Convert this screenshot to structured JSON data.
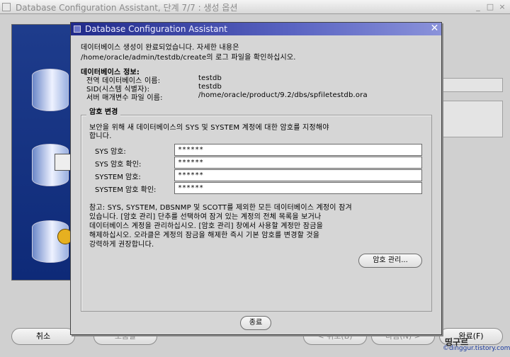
{
  "background_window": {
    "title": "Database Configuration Assistant, 단계 7/7 : 생성 옵션",
    "buttons": {
      "cancel": "취소",
      "help": "도움말",
      "back": "< 뒤로(B)",
      "next": "다음(N) >",
      "finish": "완료(F)"
    }
  },
  "dialog": {
    "title": "Database Configuration Assistant",
    "intro_line1": "데이터베이스 생성이 완료되었습니다. 자세한 내용은",
    "intro_line2": "/home/oracle/admin/testdb/create의 로그 파일을 확인하십시오.",
    "info_header": "데이터베이스 정보:",
    "info": [
      {
        "label": "전역 데이터베이스 이름:",
        "value": "testdb"
      },
      {
        "label": "SID(시스템 식별자):",
        "value": "testdb"
      },
      {
        "label": "서버 매개변수 파일 이름:",
        "value": "/home/oracle/product/9.2/dbs/spfiletestdb.ora"
      }
    ],
    "password_group": {
      "title": "암호 변경",
      "desc_line1": "보안을 위해 새 데이터베이스의 SYS 및 SYSTEM 계정에 대한 암호를 지정해야",
      "desc_line2": "합니다.",
      "fields": [
        {
          "label": "SYS 암호:",
          "value": "******"
        },
        {
          "label": "SYS 암호 확인:",
          "value": "******"
        },
        {
          "label": "SYSTEM 암호:",
          "value": "******"
        },
        {
          "label": "SYSTEM 암호 확인:",
          "value": "******"
        }
      ],
      "note_lines": [
        "참고: SYS, SYSTEM, DBSNMP 및 SCOTT를 제외한 모든 데이터베이스 계정이 잠겨",
        "있습니다. [암호 관리] 단추를 선택하여 잠겨 있는 계정의 전체 목록을 보거나",
        "데이터베이스 계정을 관리하십시오. [암호 관리] 창에서 사용할 계정만 잠금을",
        "해제하십시오. 오라클은 계정의 잠금을 해제한 즉시 기본 암호를 변경할 것을",
        "강력하게 권장합니다."
      ],
      "manage_button": "암호 관리..."
    },
    "exit_button": "종료"
  },
  "watermark": "©dinggur.tistory.com",
  "watermark_logo": "띵구르"
}
